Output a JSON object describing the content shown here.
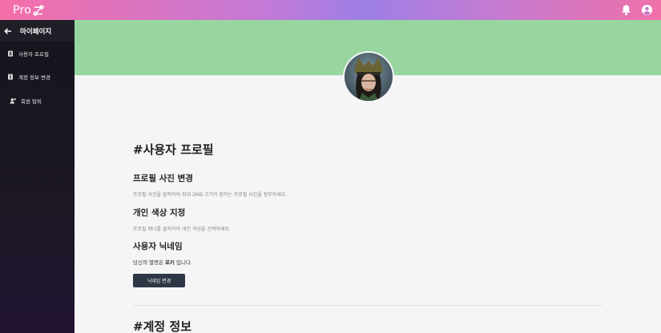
{
  "header": {
    "logo_text": "Pro",
    "logo_mark_icon": "pro-link-icon",
    "icons": [
      "bell-icon",
      "user-circle-icon"
    ]
  },
  "sidebar": {
    "back_label": "마이페이지",
    "items": [
      {
        "label": "사용자 프로필",
        "icon": "profile-card-icon"
      },
      {
        "label": "계정 정보 변경",
        "icon": "account-edit-icon"
      },
      {
        "label": "회원 탈퇴",
        "icon": "user-remove-icon"
      }
    ]
  },
  "profile": {
    "page_title": "#사용자 프로필",
    "photo": {
      "title": "프로필 사진 변경",
      "desc": "프로필 사진을 클릭하여 최대 2MB 크기의 원하는 프로필 사진을 첨부하세요."
    },
    "color": {
      "title": "개인 색상 지정",
      "desc": "프로필 배너를 클릭하여 개인 색상을 선택하세요."
    },
    "nickname": {
      "title": "사용자 닉네임",
      "prefix": "당신의 별명은 ",
      "value": "로키",
      "suffix": " 입니다.",
      "button": "닉네임 변경"
    }
  },
  "account": {
    "page_title": "#계정 정보"
  },
  "colors": {
    "banner": "#98d6a0",
    "sidebar": "#15151c",
    "button": "#2f3746"
  }
}
